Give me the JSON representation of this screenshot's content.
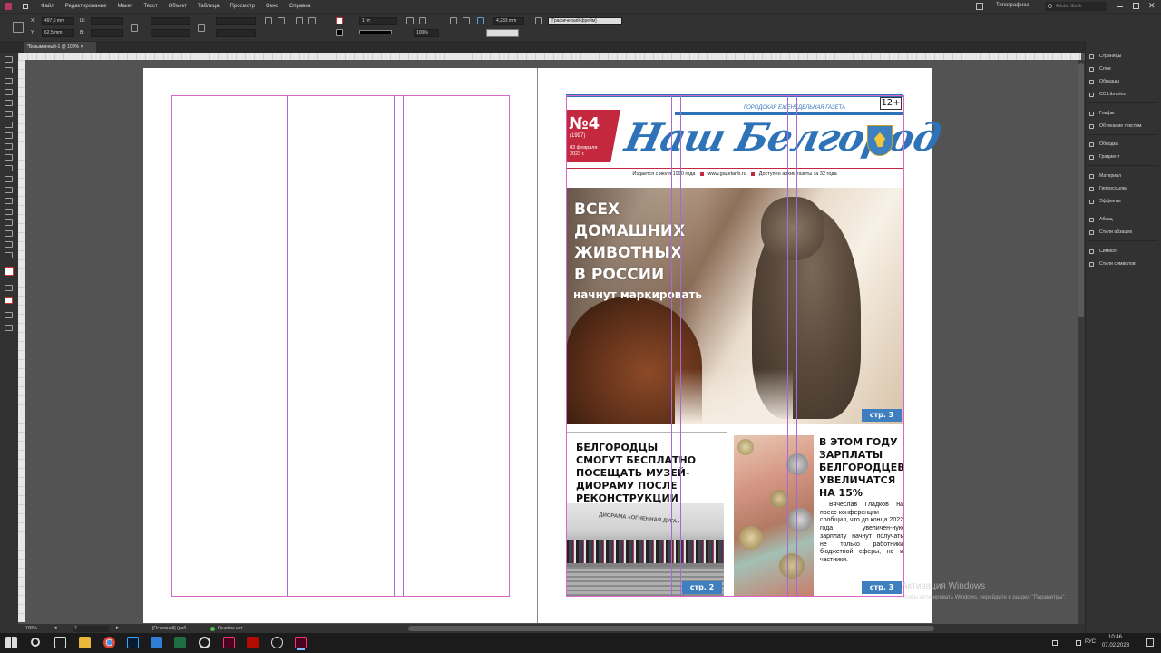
{
  "menu": [
    "Файл",
    "Редактирование",
    "Макет",
    "Текст",
    "Объект",
    "Таблица",
    "Просмотр",
    "Окно",
    "Справка"
  ],
  "workspace": "Типографика",
  "search_placeholder": "Adobe Stock",
  "control": {
    "x_label": "X:",
    "x_value": "497,5 mm",
    "y_label": "Y:",
    "y_value": "62,5 mm",
    "w_label": "Ш:",
    "h_label": "В:",
    "stroke_weight": "1 пт",
    "zoom": "100%",
    "offset": "4,233 mm",
    "frame_style": "[Графический фрейм]"
  },
  "document_tab": "*Безымянный-1 @ 100%",
  "panels": [
    "Страницы",
    "Слои",
    "Образцы",
    "CC Libraries",
    "Глифы",
    "Обтекание текстом",
    "Обводка",
    "Градиент",
    "Материал",
    "Гиперссылки",
    "Эффекты",
    "Абзац",
    "Стили абзацев",
    "Символ",
    "Стили символов"
  ],
  "status": {
    "zoom": "100%",
    "page": "2",
    "style": "[Основной] (раб...",
    "preflight": "Ошибок нет"
  },
  "newspaper": {
    "issue": "№4",
    "year": "(1997)",
    "date": "03 февраля 2023 г.",
    "masthead": "Наш Белгород",
    "subtitle": "ГОРОДСКАЯ ЕЖЕНЕДЕЛЬНАЯ ГАЗЕТА",
    "age": "12+",
    "tagline_1": "Издается с июля 1990 года",
    "tagline_2": "www.gazetanb.ru",
    "tagline_3": "Доступен архив газеты за 32 года",
    "headline_lines": [
      "ВСЕХ",
      "ДОМАШНИХ",
      "ЖИВОТНЫХ",
      "В РОССИИ"
    ],
    "headline_sub": "начнут маркировать",
    "badge_main": "стр. 3",
    "story2_title": "БЕЛГОРОДЦЫ СМОГУТ БЕСПЛАТНО ПОСЕЩАТЬ МУЗЕЙ-ДИОРАМУ ПОСЛЕ РЕКОНСТРУКЦИИ",
    "story2_badge": "стр. 2",
    "story2_sign": "ДИОРАМА «ОГНЕННАЯ ДУГА»",
    "story3_title": "В ЭТОМ ГОДУ ЗАРПЛАТЫ БЕЛГОРОДЦЕВ УВЕЛИЧАТСЯ НА 15%",
    "story3_body": "Вячеслав Гладков на пресс-конференции сообщил, что до конца 2022 года увеличен-ную зарплату начнут получать не только работники бюджетной сферы, но и частники.",
    "story3_badge": "стр. 3"
  },
  "watermark": {
    "title": "Активация Windows",
    "sub": "Чтобы активировать Windows, перейдите в раздел \"Параметры\"."
  },
  "taskbar": {
    "lang": "РУС",
    "time": "10:46",
    "date": "07.02.2023"
  },
  "colors": {
    "accent": "#2e73b8",
    "issue_red": "#c3283f"
  }
}
